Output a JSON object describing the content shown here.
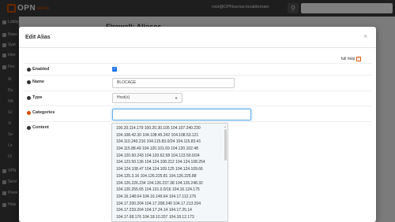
{
  "navbar": {
    "brand": "OPN",
    "brand_suffix": "sense",
    "user": "root@OPNsense.localdomain",
    "search_icon": "search-icon",
    "search_placeholder": ""
  },
  "sidebar": {
    "items": [
      {
        "label": "Lobby",
        "icon": "home-icon"
      },
      {
        "label": "Repo",
        "icon": "list-icon"
      },
      {
        "label": "Syst",
        "icon": "gear-icon"
      },
      {
        "label": "Inter",
        "icon": "network-icon"
      },
      {
        "label": "Fire",
        "icon": "fire-icon"
      }
    ],
    "subitems": [
      "Al",
      "Ru",
      "NA",
      "Gr",
      "Vi",
      "Se",
      "Lo",
      "Di"
    ],
    "bottom_items": [
      {
        "label": "VPN",
        "icon": "vpn-icon"
      },
      {
        "label": "Servi",
        "icon": "services-icon"
      },
      {
        "label": "Powe",
        "icon": "power-icon"
      },
      {
        "label": "Help",
        "icon": "help-icon"
      }
    ]
  },
  "page": {
    "title": "Firewall: Aliases"
  },
  "modal": {
    "title": "Edit Alias",
    "close": "×",
    "full_help": "full help",
    "fields": {
      "enabled_label": "Enabled",
      "enabled_checked": true,
      "name_label": "Name",
      "name_value": "BLOCAGE",
      "type_label": "Type",
      "type_value": "Host(s)",
      "categories_label": "Categories",
      "categories_value": "",
      "content_label": "Content"
    },
    "content_lines": [
      "100.20.114.179 100.20.30.105 104.107.240.230",
      "104.108.42.30 104.108.45.242 104.108.53.121",
      "104.110.240.216 104.115.83.0/24 104.115.83.41",
      "104.115.88.49 104.120.101.69 104.120.102.48",
      "104.120.60.243 104.120.62.58 104.123.50.0/24",
      "104.123.50.136 104.124.108.212 104.124.108.254",
      "104.124.108.47 104.124.109.125 104.124.109.66",
      "104.125.3.16 104.126.225.81 104.126.225.88",
      "104.126.226.234 104.126.237.38 104.126.248.32",
      "104.126.255.65 104.131.0.0/16 104.16.124.175",
      "104.16.148.64 104.16.149.64 104.17.112.176",
      "104.17.200.204 104.17.208.240 104.17.213.204",
      "104.17.233.204 104.17.24.14 104.17.25.14",
      "104.17.68.176 104.18.10.207 104.18.12.173"
    ]
  }
}
